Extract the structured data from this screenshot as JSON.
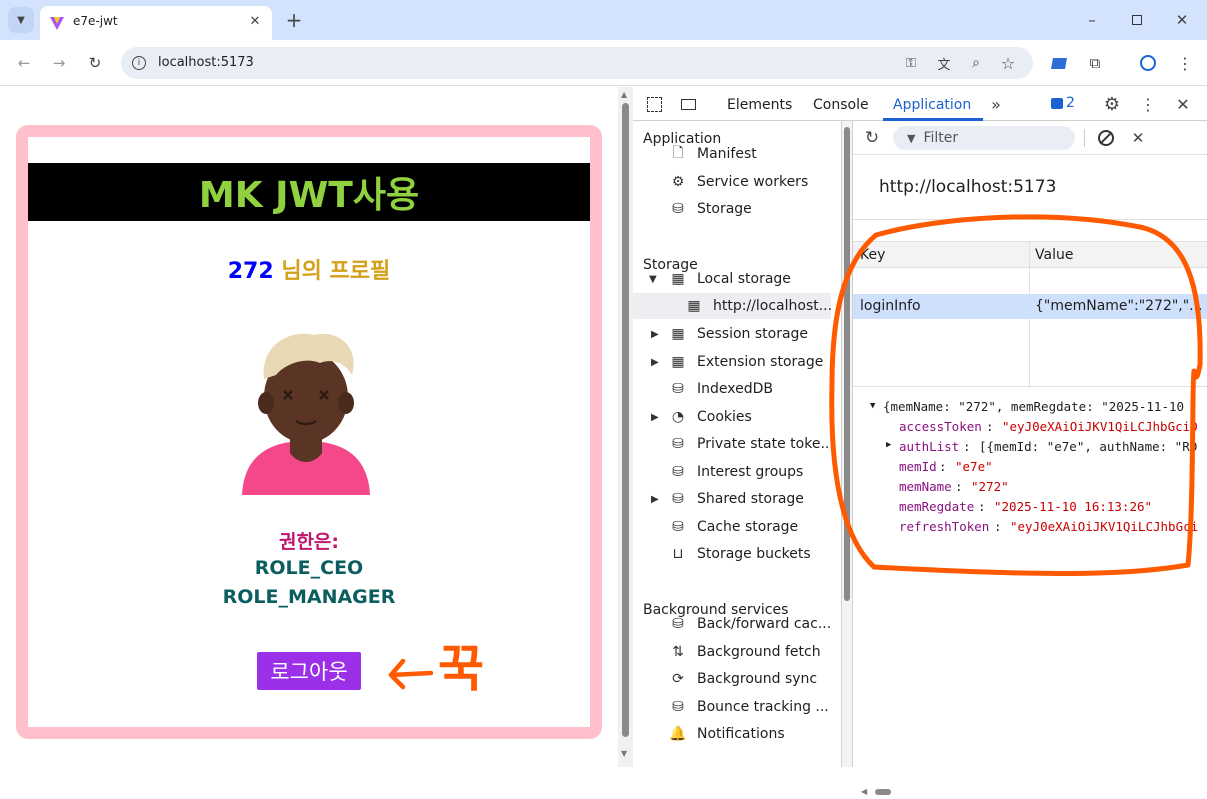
{
  "browser": {
    "tab_title": "e7e-jwt",
    "url": "localhost:5173",
    "window_controls": [
      "minimize-icon",
      "maximize-icon",
      "close-icon"
    ]
  },
  "page": {
    "banner_title": "MK JWT사용",
    "profile_number": "272",
    "profile_suffix": "님의 프로필",
    "roles_heading": "권한은:",
    "roles": [
      "ROLE_CEO",
      "ROLE_MANAGER"
    ],
    "logout_label": "로그아웃",
    "annotation_text": "꾹",
    "colors": {
      "card_border": "#ffc0cb",
      "banner_text": "#8fd13f",
      "profile_number": "#0000ff",
      "profile_suffix": "#d4a017",
      "roles_heading": "#c0166e",
      "roles": "#0b5d5e",
      "logout_bg": "#9b30e8",
      "annotation": "#ff5a00"
    }
  },
  "devtools": {
    "tabs": [
      "Elements",
      "Console",
      "Application"
    ],
    "active_tab": "Application",
    "issues_count": "2",
    "sidebar": {
      "application_header": "Application",
      "application_items": [
        "Manifest",
        "Service workers",
        "Storage"
      ],
      "storage_header": "Storage",
      "storage_items": [
        "Local storage",
        "http://localhost...",
        "Session storage",
        "Extension storage",
        "IndexedDB",
        "Cookies",
        "Private state toke...",
        "Interest groups",
        "Shared storage",
        "Cache storage",
        "Storage buckets"
      ],
      "background_header": "Background services",
      "background_items": [
        "Back/forward cac...",
        "Background fetch",
        "Background sync",
        "Bounce tracking ...",
        "Notifications"
      ]
    },
    "main": {
      "filter_placeholder": "Filter",
      "origin": "http://localhost:5173",
      "columns": [
        "Key",
        "Value"
      ],
      "rows": [
        {
          "key": "loginInfo",
          "value": "{\"memName\":\"272\",\"..."
        }
      ],
      "object_preview": {
        "summary": "{memName: \"272\", memRegdate: \"2025-11-10",
        "props": [
          {
            "key": "accessToken",
            "value": "\"eyJ0eXAiOiJKV1QiLCJhbGciO"
          },
          {
            "key": "authList",
            "value": "[{memId: \"e7e\", authName: \"RO"
          },
          {
            "key": "memId",
            "value": "\"e7e\""
          },
          {
            "key": "memName",
            "value": "\"272\""
          },
          {
            "key": "memRegdate",
            "value": "\"2025-11-10 16:13:26\""
          },
          {
            "key": "refreshToken",
            "value": "\"eyJ0eXAiOiJKV1QiLCJhbGci"
          }
        ]
      }
    }
  }
}
